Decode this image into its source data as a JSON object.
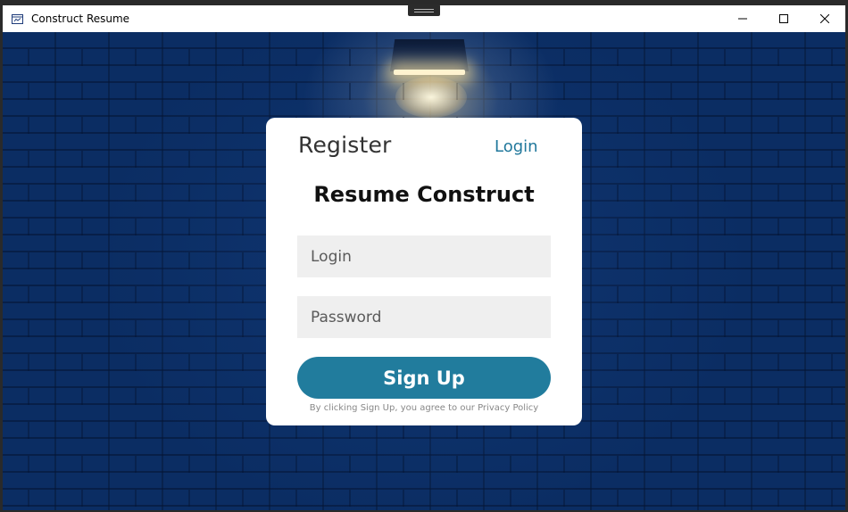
{
  "window": {
    "title": "Construct Resume",
    "controls": {
      "minimize_icon": "minimize-icon",
      "maximize_icon": "maximize-icon",
      "close_icon": "close-icon"
    }
  },
  "card": {
    "register_tab": "Register",
    "login_tab": "Login",
    "heading": "Resume Construct",
    "login_placeholder": "Login",
    "password_placeholder": "Password",
    "signup_label": "Sign Up",
    "policy_text": "By clicking Sign Up, you agree to our Privacy Policy"
  },
  "colors": {
    "accent": "#217c9d",
    "wall": "#0b2d63",
    "card_bg": "#ffffff",
    "field_bg": "#efefef"
  }
}
